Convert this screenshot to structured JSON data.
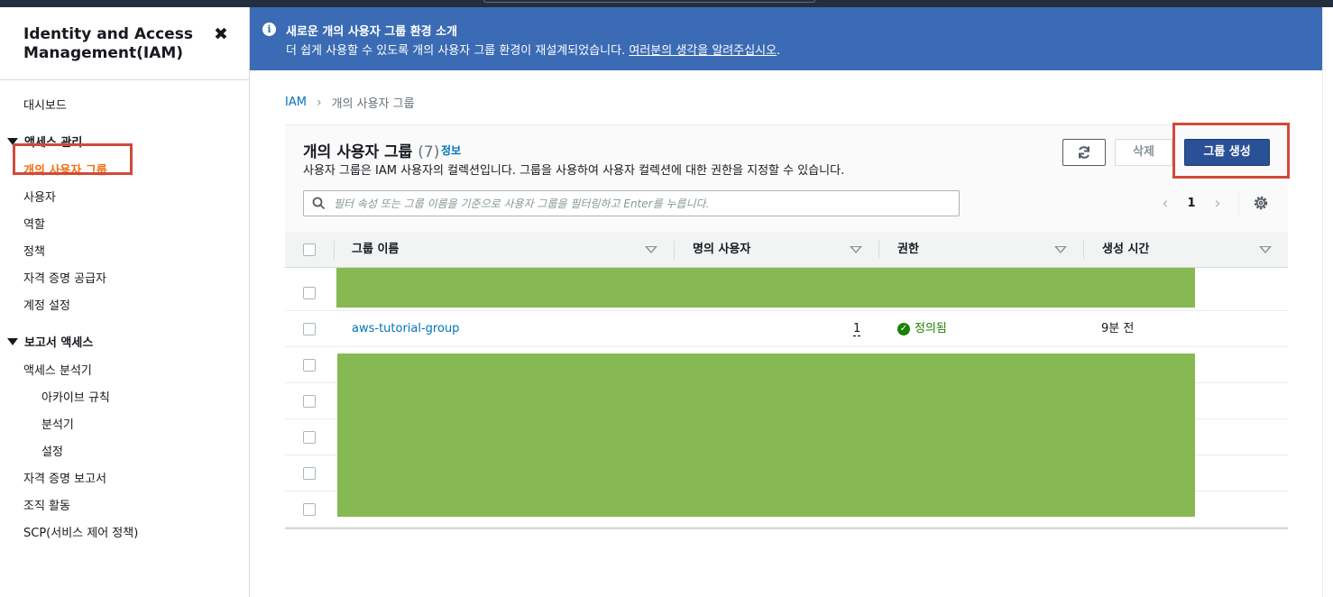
{
  "sidebar": {
    "title": "Identity and Access Management(IAM)",
    "close_icon": "✖",
    "dashboard": "대시보드",
    "access_management": {
      "label": "액세스 관리",
      "items": [
        "개의 사용자 그룹",
        "사용자",
        "역할",
        "정책",
        "자격 증명 공급자",
        "계정 설정"
      ]
    },
    "access_reports": {
      "label": "보고서 액세스",
      "items": [
        "액세스 분석기",
        "아카이브 규칙",
        "분석기",
        "설정",
        "자격 증명 보고서",
        "조직 활동",
        "SCP(서비스 제어 정책)"
      ]
    }
  },
  "flash": {
    "title": "새로운 개의 사용자 그룹 환경 소개",
    "body": "더 쉽게 사용할 수 있도록 개의 사용자 그룹 환경이 재설계되었습니다.",
    "link": "여러분의 생각을 알려주십시오",
    "period": "."
  },
  "breadcrumb": {
    "root": "IAM",
    "current": "개의 사용자 그룹"
  },
  "panel": {
    "title": "개의 사용자 그룹",
    "count": "(7)",
    "info": "정보",
    "description": "사용자 그룹은 IAM 사용자의 컬렉션입니다. 그룹을 사용하여 사용자 컬렉션에 대한 권한을 지정할 수 있습니다.",
    "delete_label": "삭제",
    "create_label": "그룹 생성",
    "filter_placeholder": "필터 속성 또는 그룹 이름을 기준으로 사용자 그룹을 필터링하고 Enter를 누릅니다.",
    "page": "1"
  },
  "table": {
    "columns": [
      "그룹 이름",
      "명의 사용자",
      "권한",
      "생성 시간"
    ],
    "rows": [
      {
        "name": "aws-tutorial-group",
        "users": "1",
        "permissions": "정의됨",
        "created": "9분 전"
      }
    ]
  },
  "colors": {
    "accent": "#ec7211",
    "link": "#0073bb",
    "banner": "#3b6bb4",
    "primary_button": "#2a5196",
    "success": "#1d8102",
    "highlight_box": "#d2493a",
    "redaction": "#86b951"
  }
}
